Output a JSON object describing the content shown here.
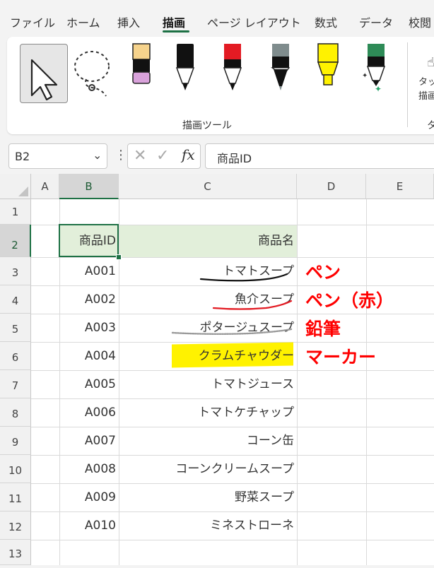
{
  "menu": {
    "tabs": [
      "ファイル",
      "ホーム",
      "挿入",
      "描画",
      "ページ レイアウト",
      "数式",
      "データ",
      "校閲"
    ],
    "active_tab": "描画"
  },
  "ribbon": {
    "group_label": "描画ツール",
    "touch_label_line1": "タッ",
    "touch_label_line2": "描画",
    "partial_group_label": "タ",
    "pen_colors": [
      "#f6d38c",
      "#111111",
      "#e31b23",
      "#7f8c8d",
      "#fff200",
      "#2e8b57"
    ]
  },
  "formula_bar": {
    "name_box": "B2",
    "fx": "fx",
    "content": "商品ID"
  },
  "grid": {
    "columns": [
      "A",
      "B",
      "C",
      "D",
      "E"
    ],
    "rows": [
      "1",
      "2",
      "3",
      "4",
      "5",
      "6",
      "7",
      "8",
      "9",
      "10",
      "11",
      "12",
      "13"
    ],
    "selected_column": "B",
    "selected_row": "2",
    "header": {
      "id": "商品ID",
      "name": "商品名"
    },
    "items": [
      {
        "id": "A001",
        "name": "トマトスープ"
      },
      {
        "id": "A002",
        "name": "魚介スープ"
      },
      {
        "id": "A003",
        "name": "ポタージュスープ"
      },
      {
        "id": "A004",
        "name": "クラムチャウダー"
      },
      {
        "id": "A005",
        "name": "トマトジュース"
      },
      {
        "id": "A006",
        "name": "トマトケチャップ"
      },
      {
        "id": "A007",
        "name": "コーン缶"
      },
      {
        "id": "A008",
        "name": "コーンクリームスープ"
      },
      {
        "id": "A009",
        "name": "野菜スープ"
      },
      {
        "id": "A010",
        "name": "ミネストローネ"
      }
    ]
  },
  "annotations": [
    "ペン",
    "ペン（赤）",
    "鉛筆",
    "マーカー"
  ],
  "colors": {
    "accent": "#1e7145",
    "annotation": "#ff0000",
    "marker": "#fff200",
    "header_fill": "#e2efda"
  }
}
